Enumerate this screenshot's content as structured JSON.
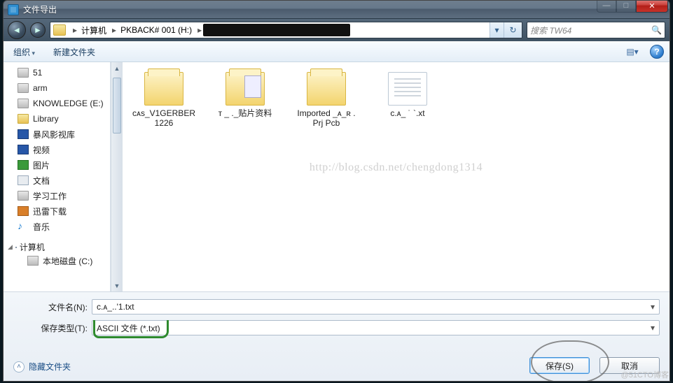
{
  "title": "文件导出",
  "window_buttons": {
    "min": "—",
    "max": "□",
    "close": "✕"
  },
  "address": {
    "root": "计算机",
    "drive": "PKBACK# 001 (H:)",
    "chevron": "▸",
    "dropdown": "▾",
    "refresh": "↻"
  },
  "search": {
    "placeholder": "搜索 TW64",
    "icon": "🔍"
  },
  "toolbar": {
    "organize": "组织",
    "newfolder": "新建文件夹",
    "view_icon": "▤▾",
    "help": "?"
  },
  "sidebar": {
    "items": [
      {
        "label": "51",
        "icon": "i-disk"
      },
      {
        "label": "arm",
        "icon": "i-disk"
      },
      {
        "label": "KNOWLEDGE (E:)",
        "icon": "i-disk"
      },
      {
        "label": "Library",
        "icon": "i-fold"
      },
      {
        "label": "暴风影视库",
        "icon": "i-vid"
      },
      {
        "label": "视频",
        "icon": "i-vid"
      },
      {
        "label": "图片",
        "icon": "i-pic"
      },
      {
        "label": "文档",
        "icon": "i-doc"
      },
      {
        "label": "学习工作",
        "icon": "i-disk"
      },
      {
        "label": "迅雷下载",
        "icon": "i-dl"
      },
      {
        "label": "音乐",
        "icon": "i-music",
        "glyph": "♪"
      }
    ],
    "group": {
      "label": "计算机",
      "icon": "i-comp"
    },
    "sub": {
      "label": "本地磁盘 (C:)",
      "icon": "i-ldisk"
    }
  },
  "files": [
    {
      "label": "ᴄᴀs_V1GERBER1226",
      "type": "folder-open"
    },
    {
      "label": "ᴛ  _ ._贴片资料",
      "type": "folder-inner"
    },
    {
      "label": "Imported _ᴀ_ʀ .Prj Pcb",
      "type": "folder-open"
    },
    {
      "label": "ᴄ.ᴀ_ ˙ `.xt",
      "type": "txt"
    }
  ],
  "watermark": "http://blog.csdn.net/chengdong1314",
  "corner_watermark": "@51CTO博客",
  "form": {
    "filename_label": "文件名(N):",
    "filename_value": "ᴄ.ᴀ_..'1.txt",
    "filetype_label": "保存类型(T):",
    "filetype_value": "ASCII 文件 (*.txt)"
  },
  "buttons": {
    "save": "保存(S)",
    "cancel": "取消"
  },
  "hide_folders": "隐藏文件夹"
}
